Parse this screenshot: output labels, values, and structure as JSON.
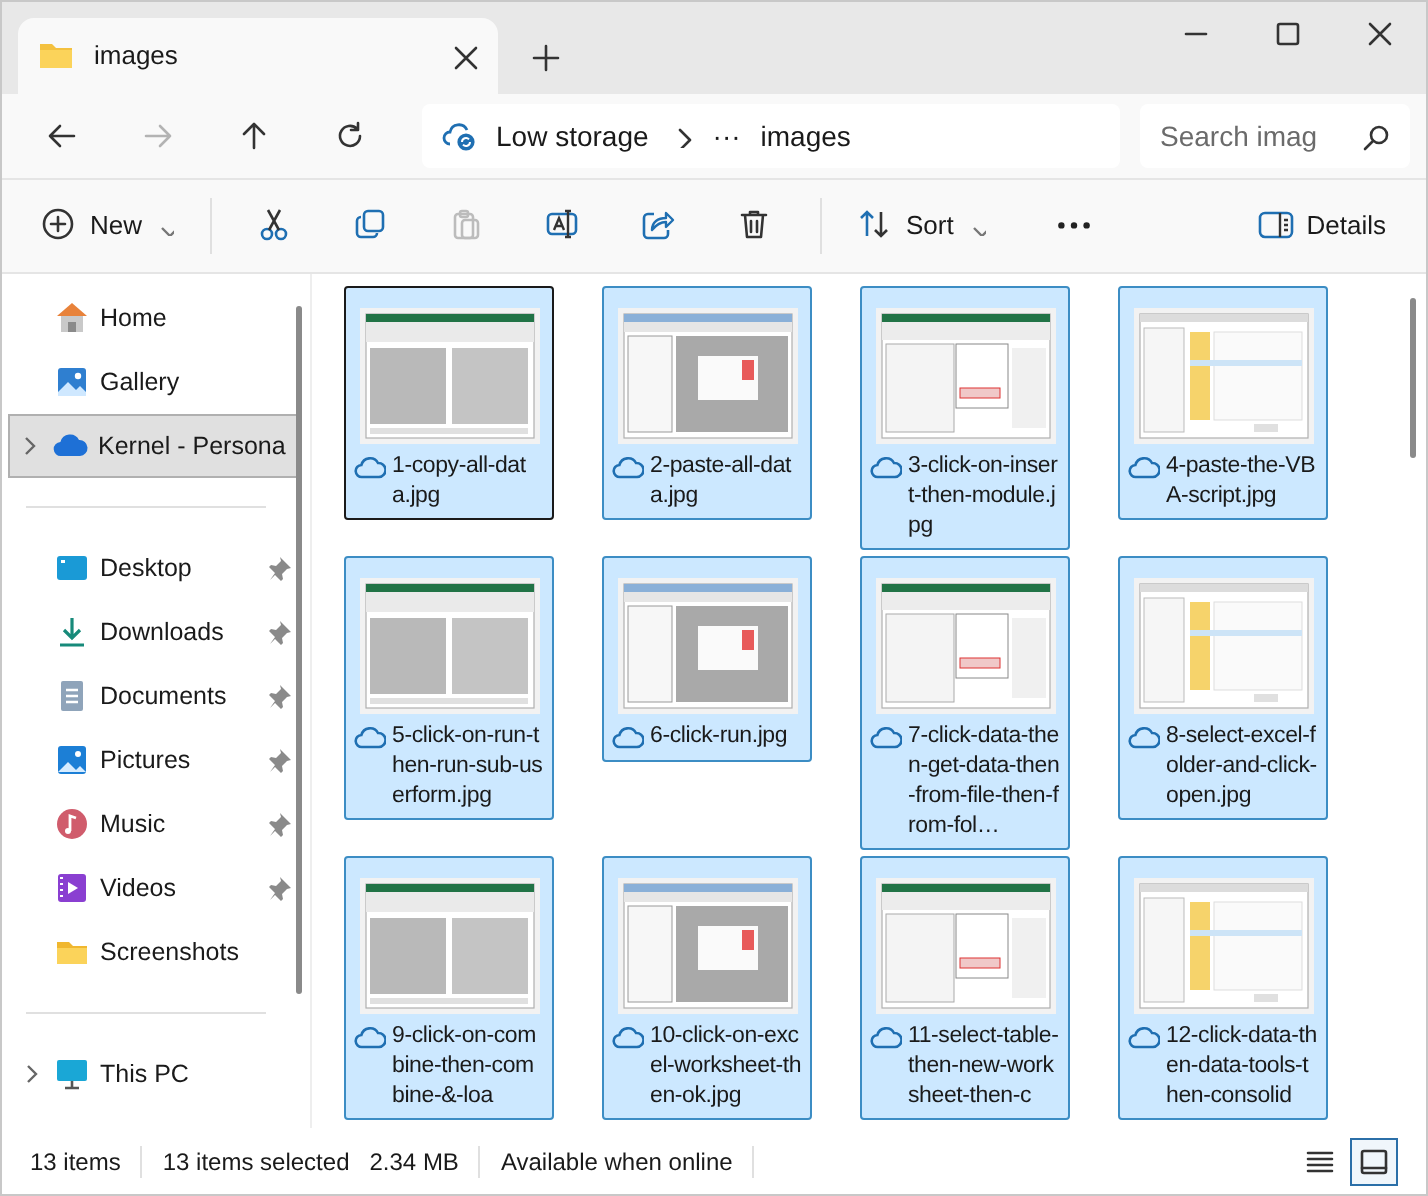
{
  "tab": {
    "title": "images",
    "selected": true
  },
  "nav_buttons": [
    {
      "kind": "back",
      "disabled": false
    },
    {
      "kind": "forward",
      "disabled": true
    },
    {
      "kind": "up",
      "disabled": false
    },
    {
      "kind": "refresh",
      "disabled": false
    }
  ],
  "address": {
    "location": "Low storage",
    "overflow": "···",
    "folder": "images"
  },
  "search": {
    "placeholder": "Search imag"
  },
  "toolbar": [
    {
      "kind": "new",
      "label": "New",
      "disabled": false
    },
    {
      "kind": "cut",
      "disabled": false
    },
    {
      "kind": "copy",
      "disabled": false
    },
    {
      "kind": "paste",
      "disabled": true
    },
    {
      "kind": "rename",
      "disabled": false
    },
    {
      "kind": "share",
      "disabled": false
    },
    {
      "kind": "delete",
      "disabled": false
    },
    {
      "kind": "sort",
      "label": "Sort",
      "disabled": false
    },
    {
      "kind": "more",
      "disabled": false
    }
  ],
  "details_button": {
    "label": "Details"
  },
  "sidebar": {
    "groups": [
      [
        {
          "kind": "home",
          "label": "Home",
          "pinned": false,
          "expandable": false,
          "selected": false
        },
        {
          "kind": "gallery",
          "label": "Gallery",
          "pinned": false,
          "expandable": false,
          "selected": false
        },
        {
          "kind": "cloud",
          "label": "Kernel - Persona",
          "pinned": false,
          "expandable": true,
          "selected": true
        }
      ],
      [
        {
          "kind": "desktop",
          "label": "Desktop",
          "pinned": true,
          "expandable": false,
          "selected": false
        },
        {
          "kind": "downloads",
          "label": "Downloads",
          "pinned": true,
          "expandable": false,
          "selected": false
        },
        {
          "kind": "documents",
          "label": "Documents",
          "pinned": true,
          "expandable": false,
          "selected": false
        },
        {
          "kind": "pictures",
          "label": "Pictures",
          "pinned": true,
          "expandable": false,
          "selected": false
        },
        {
          "kind": "music",
          "label": "Music",
          "pinned": true,
          "expandable": false,
          "selected": false
        },
        {
          "kind": "videos",
          "label": "Videos",
          "pinned": true,
          "expandable": false,
          "selected": false
        },
        {
          "kind": "folder",
          "label": "Screenshots",
          "pinned": false,
          "expandable": false,
          "selected": false
        }
      ],
      [
        {
          "kind": "pc",
          "label": "This PC",
          "pinned": false,
          "expandable": true,
          "selected": false
        }
      ]
    ]
  },
  "files": [
    {
      "name": "1-copy-all-data.jpg",
      "selected": true,
      "focused": true
    },
    {
      "name": "2-paste-all-data.jpg",
      "selected": true,
      "focused": false
    },
    {
      "name": "3-click-on-insert-then-module.jpg",
      "selected": true,
      "focused": false
    },
    {
      "name": "4-paste-the-VBA-script.jpg",
      "selected": true,
      "focused": false
    },
    {
      "name": "5-click-on-run-then-run-sub-userform.jpg",
      "selected": true,
      "focused": false
    },
    {
      "name": "6-click-run.jpg",
      "selected": true,
      "focused": false
    },
    {
      "name": "7-click-data-then-get-data-then-from-file-then-from-fol…",
      "selected": true,
      "focused": false
    },
    {
      "name": "8-select-excel-folder-and-click-open.jpg",
      "selected": true,
      "focused": false
    },
    {
      "name": "9-click-on-combine-then-combine-&-loa",
      "selected": true,
      "focused": false
    },
    {
      "name": "10-click-on-excel-worksheet-then-ok.jpg",
      "selected": true,
      "focused": false
    },
    {
      "name": "11-select-table-then-new-worksheet-then-c",
      "selected": true,
      "focused": false
    },
    {
      "name": "12-click-data-then-data-tools-then-consolid",
      "selected": true,
      "focused": false
    }
  ],
  "status_bar": {
    "count": "13 items",
    "selection": "13 items selected",
    "size": "2.34 MB",
    "availability": "Available when online"
  },
  "view_buttons": [
    {
      "kind": "details",
      "selected": false
    },
    {
      "kind": "tiles",
      "selected": true
    }
  ]
}
